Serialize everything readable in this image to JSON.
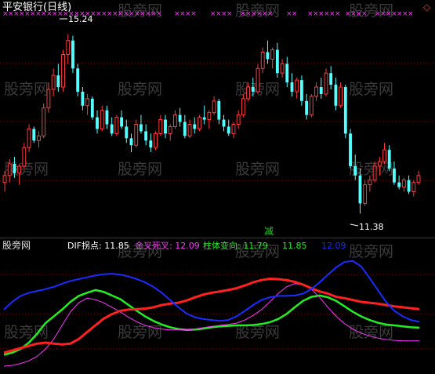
{
  "colors": {
    "background": "#000000",
    "up": "#ff3b3b",
    "down": "#54ffff",
    "grid": "#8b0000",
    "divider": "#c00000",
    "title": "#ffffff",
    "marker": "#ff33ff",
    "jian": "#22cc22",
    "dif": "#ffffff",
    "jiancha": "#ff33ff",
    "zhuti": "#22ee22",
    "blue": "#1a2cff",
    "red_line": "#ff2020",
    "watermark": "#3a3a3a"
  },
  "header": {
    "title": "平安银行(日线)",
    "diamond": "◇"
  },
  "annotations": {
    "high": "15.24",
    "low": "11.38",
    "signal": "减"
  },
  "indicator_header": {
    "name": "股旁网",
    "dif_label": "DIF拐点: 11.85",
    "golden_label": "金叉死叉: 12.09",
    "pillar_label": "柱体变向: 11.79",
    "value_a": "11.85",
    "value_b": "12.09"
  },
  "watermark": "股旁网",
  "chart_data": [
    {
      "type": "candlestick",
      "title": "平安银行(日线)",
      "high_label": "15.24",
      "low_label": "11.38",
      "ylim": [
        11.0,
        15.6
      ],
      "candles": [
        [
          12.05,
          12.3,
          11.85,
          12.2
        ],
        [
          12.2,
          12.55,
          12.05,
          12.45
        ],
        [
          12.45,
          12.6,
          12.15,
          12.25
        ],
        [
          12.25,
          12.45,
          12.0,
          12.4
        ],
        [
          12.4,
          12.9,
          12.35,
          12.8
        ],
        [
          12.8,
          13.3,
          12.7,
          13.2
        ],
        [
          13.2,
          13.25,
          12.9,
          12.95
        ],
        [
          12.95,
          13.15,
          12.8,
          13.05
        ],
        [
          13.05,
          13.75,
          13.0,
          13.65
        ],
        [
          13.65,
          14.2,
          13.55,
          14.05
        ],
        [
          14.05,
          14.5,
          13.9,
          14.35
        ],
        [
          14.35,
          14.6,
          14.0,
          14.1
        ],
        [
          14.1,
          14.9,
          14.0,
          14.8
        ],
        [
          14.8,
          15.24,
          14.6,
          15.1
        ],
        [
          15.1,
          15.2,
          14.4,
          14.5
        ],
        [
          14.5,
          14.6,
          13.9,
          14.0
        ],
        [
          14.0,
          14.1,
          13.6,
          13.7
        ],
        [
          13.7,
          13.95,
          13.5,
          13.85
        ],
        [
          13.85,
          13.9,
          13.4,
          13.45
        ],
        [
          13.45,
          13.6,
          13.1,
          13.2
        ],
        [
          13.2,
          13.7,
          13.15,
          13.6
        ],
        [
          13.6,
          13.7,
          13.2,
          13.3
        ],
        [
          13.3,
          13.45,
          13.05,
          13.1
        ],
        [
          13.1,
          13.5,
          13.05,
          13.45
        ],
        [
          13.45,
          13.6,
          13.2,
          13.25
        ],
        [
          13.25,
          13.4,
          12.9,
          13.0
        ],
        [
          13.0,
          13.1,
          12.7,
          12.85
        ],
        [
          12.85,
          13.4,
          12.8,
          13.3
        ],
        [
          13.3,
          13.5,
          13.1,
          13.15
        ],
        [
          13.15,
          13.3,
          12.85,
          12.95
        ],
        [
          12.95,
          13.1,
          12.7,
          12.8
        ],
        [
          12.8,
          13.15,
          12.75,
          13.1
        ],
        [
          13.1,
          13.5,
          13.05,
          13.4
        ],
        [
          13.4,
          13.5,
          13.0,
          13.1
        ],
        [
          13.1,
          13.3,
          12.95,
          13.25
        ],
        [
          13.25,
          13.6,
          13.2,
          13.5
        ],
        [
          13.5,
          13.65,
          13.25,
          13.35
        ],
        [
          13.35,
          13.5,
          13.0,
          13.05
        ],
        [
          13.05,
          13.4,
          13.0,
          13.3
        ],
        [
          13.3,
          13.45,
          13.1,
          13.2
        ],
        [
          13.2,
          13.5,
          13.15,
          13.45
        ],
        [
          13.45,
          13.7,
          13.3,
          13.4
        ],
        [
          13.4,
          13.6,
          13.2,
          13.55
        ],
        [
          13.55,
          13.9,
          13.5,
          13.8
        ],
        [
          13.8,
          13.85,
          13.3,
          13.4
        ],
        [
          13.4,
          13.5,
          13.15,
          13.25
        ],
        [
          13.25,
          13.4,
          13.05,
          13.1
        ],
        [
          13.1,
          13.35,
          13.0,
          13.3
        ],
        [
          13.3,
          13.6,
          13.2,
          13.5
        ],
        [
          13.5,
          13.95,
          13.45,
          13.85
        ],
        [
          13.85,
          14.2,
          13.8,
          14.1
        ],
        [
          14.1,
          14.3,
          13.9,
          14.0
        ],
        [
          14.0,
          14.6,
          13.95,
          14.5
        ],
        [
          14.5,
          14.95,
          14.4,
          14.85
        ],
        [
          14.85,
          15.1,
          14.6,
          14.7
        ],
        [
          14.7,
          14.95,
          14.5,
          14.9
        ],
        [
          14.9,
          15.05,
          14.3,
          14.4
        ],
        [
          14.4,
          14.7,
          14.3,
          14.6
        ],
        [
          14.6,
          14.75,
          14.1,
          14.2
        ],
        [
          14.2,
          14.4,
          13.9,
          14.0
        ],
        [
          14.0,
          14.3,
          13.85,
          14.25
        ],
        [
          14.25,
          14.35,
          13.7,
          13.8
        ],
        [
          13.8,
          13.95,
          13.4,
          13.5
        ],
        [
          13.5,
          13.95,
          13.45,
          13.9
        ],
        [
          13.9,
          14.2,
          13.8,
          14.1
        ],
        [
          14.1,
          14.3,
          13.85,
          13.95
        ],
        [
          13.95,
          14.5,
          13.9,
          14.4
        ],
        [
          14.4,
          14.55,
          14.05,
          14.15
        ],
        [
          14.15,
          14.3,
          13.6,
          13.7
        ],
        [
          13.7,
          14.2,
          13.65,
          14.1
        ],
        [
          14.1,
          14.15,
          13.0,
          13.1
        ],
        [
          13.1,
          13.2,
          12.35,
          12.4
        ],
        [
          12.4,
          12.65,
          12.1,
          12.2
        ],
        [
          12.2,
          12.35,
          11.38,
          11.6
        ],
        [
          11.6,
          12.1,
          11.55,
          12.0
        ],
        [
          12.0,
          12.2,
          11.85,
          12.1
        ],
        [
          12.1,
          12.5,
          12.05,
          12.4
        ],
        [
          12.4,
          12.6,
          12.2,
          12.5
        ],
        [
          12.5,
          12.9,
          12.45,
          12.75
        ],
        [
          12.75,
          12.85,
          12.3,
          12.35
        ],
        [
          12.35,
          12.5,
          12.0,
          12.05
        ],
        [
          12.05,
          12.2,
          11.9,
          11.95
        ],
        [
          11.95,
          12.15,
          11.85,
          12.1
        ],
        [
          12.1,
          12.2,
          11.8,
          11.85
        ],
        [
          11.85,
          12.1,
          11.75,
          12.05
        ],
        [
          12.05,
          12.3,
          12.0,
          12.2
        ]
      ]
    },
    {
      "type": "line",
      "series": [
        {
          "name": "DIF拐点",
          "values": [
            11.45,
            11.5,
            11.58,
            11.72,
            11.92,
            12.15,
            12.3,
            12.45,
            12.62,
            12.75,
            12.82,
            12.88,
            12.84,
            12.76,
            12.68,
            12.55,
            12.42,
            12.3,
            12.2,
            12.12,
            12.06,
            12.02,
            12.0,
            12.01,
            12.03,
            12.06,
            12.08,
            12.09,
            12.1,
            12.1,
            12.11,
            12.13,
            12.17,
            12.24,
            12.35,
            12.5,
            12.64,
            12.73,
            12.76,
            12.72,
            12.64,
            12.52,
            12.4,
            12.3,
            12.22,
            12.16,
            12.12,
            12.1,
            12.08,
            12.06,
            12.05
          ]
        },
        {
          "name": "金叉死叉",
          "values": [
            11.2,
            11.22,
            11.26,
            11.32,
            11.42,
            11.58,
            11.8,
            12.1,
            12.4,
            12.6,
            12.7,
            12.67,
            12.6,
            12.5,
            12.4,
            12.28,
            12.18,
            12.1,
            12.05,
            12.02,
            12.0,
            12.0,
            12.0,
            12.02,
            12.05,
            12.08,
            12.1,
            12.12,
            12.15,
            12.22,
            12.32,
            12.45,
            12.62,
            12.8,
            12.95,
            13.02,
            13.0,
            12.9,
            12.72,
            12.5,
            12.3,
            12.14,
            12.02,
            11.93,
            11.87,
            11.82,
            11.79,
            11.77,
            11.76,
            11.76,
            11.76
          ]
        },
        {
          "name": "柱体变向",
          "values": [
            11.5,
            11.55,
            11.6,
            11.65,
            11.7,
            11.72,
            11.7,
            11.68,
            11.7,
            11.8,
            11.95,
            12.1,
            12.25,
            12.35,
            12.42,
            12.45,
            12.46,
            12.47,
            12.5,
            12.55,
            12.58,
            12.6,
            12.65,
            12.72,
            12.78,
            12.82,
            12.85,
            12.88,
            12.92,
            12.98,
            13.05,
            13.1,
            13.13,
            13.12,
            13.1,
            13.06,
            13.0,
            12.92,
            12.85,
            12.8,
            12.73,
            12.7,
            12.66,
            12.62,
            12.6,
            12.58,
            12.55,
            12.52,
            12.5,
            12.48,
            12.46
          ]
        },
        {
          "name": "blue",
          "values": [
            12.45,
            12.62,
            12.75,
            12.82,
            12.86,
            12.9,
            12.95,
            13.02,
            13.08,
            13.12,
            13.16,
            13.2,
            13.23,
            13.24,
            13.22,
            13.18,
            13.12,
            13.05,
            12.95,
            12.82,
            12.66,
            12.5,
            12.36,
            12.28,
            12.24,
            12.22,
            12.2,
            12.22,
            12.3,
            12.42,
            12.55,
            12.66,
            12.72,
            12.75,
            12.75,
            12.76,
            12.8,
            12.9,
            13.05,
            13.22,
            13.38,
            13.5,
            13.52,
            13.4,
            13.15,
            12.88,
            12.62,
            12.42,
            12.3,
            12.22,
            12.18
          ]
        }
      ]
    }
  ]
}
